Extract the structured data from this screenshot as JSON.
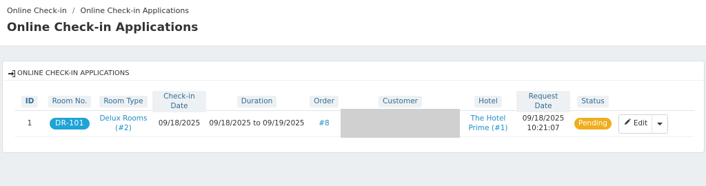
{
  "breadcrumb": {
    "items": [
      "Online Check-in",
      "Online Check-in Applications"
    ],
    "separator": "/"
  },
  "page": {
    "title": "Online Check-in Applications"
  },
  "panel": {
    "title": "ONLINE CHECK-IN APPLICATIONS",
    "icon": "sign-in-icon"
  },
  "table": {
    "headers": [
      "ID",
      "Room No.",
      "Room Type",
      "Check-in Date",
      "Duration",
      "Order",
      "Customer",
      "Hotel",
      "Request Date",
      "Status"
    ],
    "rows": [
      {
        "id": "1",
        "room_no": "DR-101",
        "room_type": "Delux Rooms\n(#2)",
        "room_type_line1": "Delux Rooms",
        "room_type_line2": "(#2)",
        "checkin_date": "09/18/2025",
        "duration": "09/18/2025 to 09/19/2025",
        "order": "#8",
        "customer": "",
        "hotel_line1": "The Hotel",
        "hotel_line2": "Prime (#1)",
        "request_date_line1": "09/18/2025",
        "request_date_line2": "10:21:07",
        "status": "Pending",
        "action_label": "Edit"
      }
    ]
  },
  "colors": {
    "link": "#1e8ec6",
    "room_badge": "#1ea4d6",
    "status_pending": "#f0ad1c",
    "header_text": "#2f6d94"
  }
}
